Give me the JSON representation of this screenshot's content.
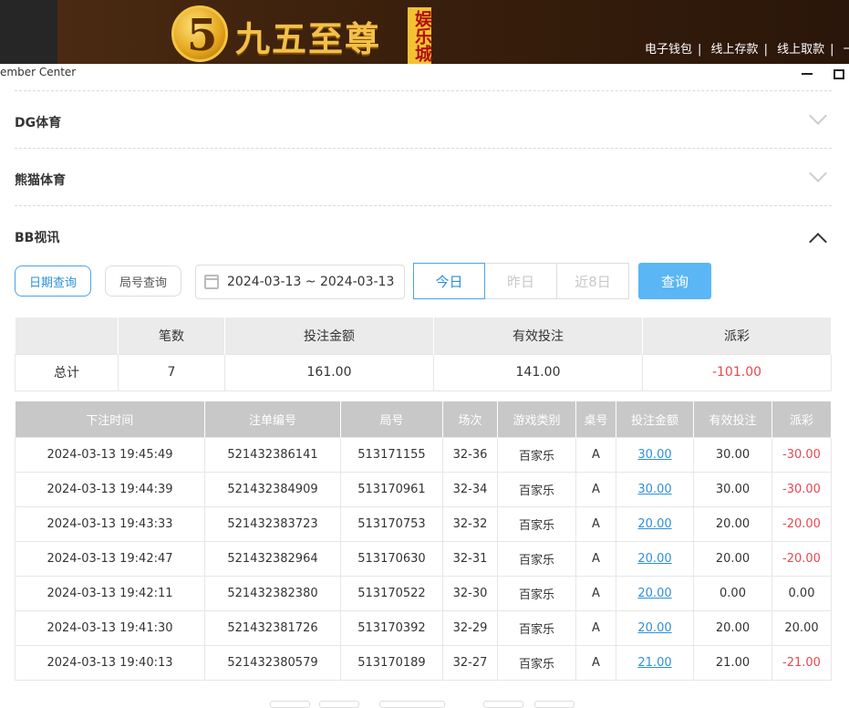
{
  "banner": {
    "logo_digit": "5",
    "logo_text": "九五至尊",
    "logo_tag": "娱乐城",
    "links": [
      "电子钱包",
      "线上存款",
      "线上取款",
      "一"
    ]
  },
  "window": {
    "title": "ember Center"
  },
  "sections": [
    {
      "label": "DG体育",
      "open": false
    },
    {
      "label": "熊猫体育",
      "open": false
    },
    {
      "label": "BB视讯",
      "open": true
    }
  ],
  "filters": {
    "date_query": "日期查询",
    "round_query": "局号查询",
    "date_range": "2024-03-13 ~ 2024-03-13",
    "today": "今日",
    "yesterday": "昨日",
    "last8": "近8日",
    "query": "查询"
  },
  "summary": {
    "headers": [
      "",
      "笔数",
      "投注金额",
      "有效投注",
      "派彩"
    ],
    "row": [
      "总计",
      "7",
      "161.00",
      "141.00",
      "-101.00"
    ]
  },
  "detail": {
    "headers": [
      "下注时间",
      "注单编号",
      "局号",
      "场次",
      "游戏类别",
      "桌号",
      "投注金额",
      "有效投注",
      "派彩"
    ],
    "rows": [
      [
        "2024-03-13 19:45:49",
        "521432386141",
        "513171155",
        "32-36",
        "百家乐",
        "A",
        "30.00",
        "30.00",
        "-30.00"
      ],
      [
        "2024-03-13 19:44:39",
        "521432384909",
        "513170961",
        "32-34",
        "百家乐",
        "A",
        "30.00",
        "30.00",
        "-30.00"
      ],
      [
        "2024-03-13 19:43:33",
        "521432383723",
        "513170753",
        "32-32",
        "百家乐",
        "A",
        "20.00",
        "20.00",
        "-20.00"
      ],
      [
        "2024-03-13 19:42:47",
        "521432382964",
        "513170630",
        "32-31",
        "百家乐",
        "A",
        "20.00",
        "20.00",
        "-20.00"
      ],
      [
        "2024-03-13 19:42:11",
        "521432382380",
        "513170522",
        "32-30",
        "百家乐",
        "A",
        "20.00",
        "0.00",
        "0.00"
      ],
      [
        "2024-03-13 19:41:30",
        "521432381726",
        "513170392",
        "32-29",
        "百家乐",
        "A",
        "20.00",
        "20.00",
        "20.00"
      ],
      [
        "2024-03-13 19:40:13",
        "521432380579",
        "513170189",
        "32-27",
        "百家乐",
        "A",
        "21.00",
        "21.00",
        "-21.00"
      ]
    ]
  },
  "colors": {
    "accent": "#2d8fdc",
    "negative": "#e8474f",
    "button": "#5bb6f5"
  }
}
